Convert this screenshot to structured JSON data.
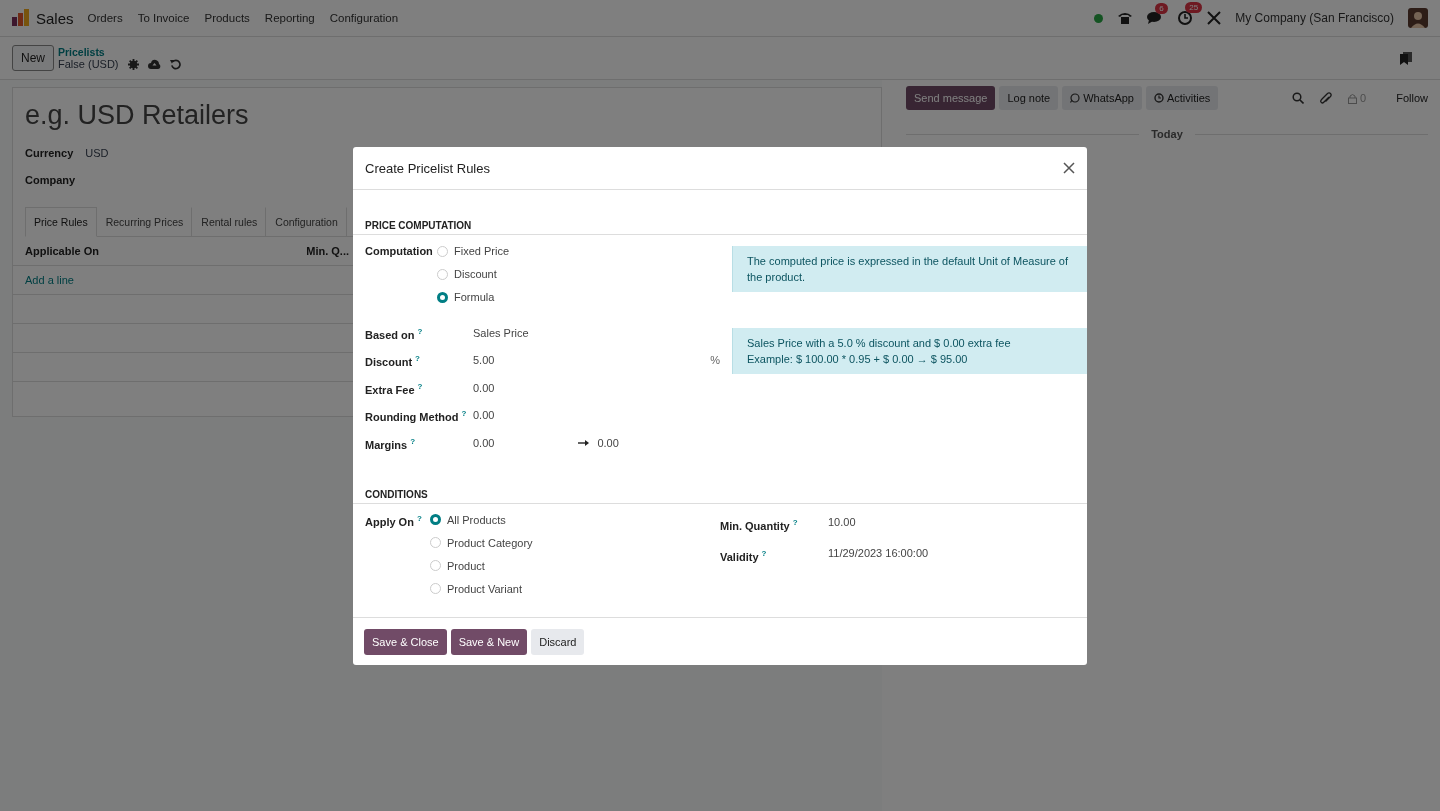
{
  "navbar": {
    "app": "Sales",
    "menu": [
      "Orders",
      "To Invoice",
      "Products",
      "Reporting",
      "Configuration"
    ],
    "chat_badge": "6",
    "activity_badge": "25",
    "company": "My Company (San Francisco)"
  },
  "control_panel": {
    "new_button": "New",
    "breadcrumb": "Pricelists",
    "record": "False (USD)"
  },
  "form": {
    "name_placeholder": "e.g. USD Retailers",
    "fields": [
      {
        "label": "Currency",
        "value": "USD"
      },
      {
        "label": "Company"
      }
    ],
    "tabs": [
      {
        "label": "Price Rules",
        "selected": true
      },
      {
        "label": "Recurring Prices",
        "selected": false
      },
      {
        "label": "Rental rules",
        "selected": false
      },
      {
        "label": "Configuration",
        "selected": false
      }
    ],
    "columns": [
      "Applicable On",
      "Min. Q..."
    ],
    "add_line": "Add a line"
  },
  "chatter": {
    "buttons": [
      {
        "label": "Send message",
        "selected": true,
        "kind": "text"
      },
      {
        "label": "Log note",
        "selected": false,
        "kind": "text"
      },
      {
        "label": "WhatsApp",
        "selected": false,
        "kind": "whatsapp"
      },
      {
        "label": "Activities",
        "selected": false,
        "kind": "activity"
      }
    ],
    "followers": "0",
    "follow": "Follow",
    "date_separator": "Today"
  },
  "dialog": {
    "title": "Create Pricelist Rules",
    "price_section": "PRICE COMPUTATION",
    "computation": {
      "label": "Computation",
      "options": [
        {
          "label": "Fixed Price",
          "selected": false
        },
        {
          "label": "Discount",
          "selected": false
        },
        {
          "label": "Formula",
          "selected": true
        }
      ]
    },
    "notes": [
      "The computed price is expressed in the default Unit of Measure of the product.",
      "Sales Price with a 5.0 % discount and $ 0.00 extra fee\nExample: $ 100.00 * 0.95 + $ 0.00 → $ 95.00"
    ],
    "fields": [
      {
        "label": "Based on",
        "help": "?",
        "value": "Sales Price"
      },
      {
        "label": "Discount",
        "help": "?",
        "value": "5.00",
        "unit": "%"
      },
      {
        "label": "Extra Fee",
        "help": "?",
        "value": "0.00"
      },
      {
        "label": "Rounding Method",
        "help": "?",
        "value": "0.00"
      },
      {
        "label": "Margins",
        "help": "?",
        "value": "0.00",
        "value_to": "0.00"
      }
    ],
    "conditions_section": "CONDITIONS",
    "apply_on": {
      "label": "Apply On",
      "help": "?",
      "options": [
        {
          "label": "All Products",
          "selected": true
        },
        {
          "label": "Product Category",
          "selected": false
        },
        {
          "label": "Product",
          "selected": false
        },
        {
          "label": "Product Variant",
          "selected": false
        }
      ]
    },
    "condition_fields": [
      {
        "label": "Min. Quantity",
        "help": "?",
        "value": "10.00"
      },
      {
        "label": "Validity",
        "help": "?",
        "value": "11/29/2023 16:00:00"
      }
    ],
    "buttons": [
      {
        "label": "Save & Close",
        "primary": true
      },
      {
        "label": "Save & New",
        "primary": true
      },
      {
        "label": "Discard",
        "primary": false
      }
    ]
  }
}
